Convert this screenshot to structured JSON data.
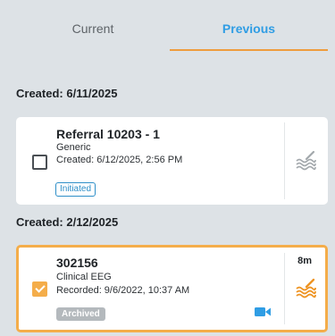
{
  "tabs": [
    {
      "label": "Current",
      "active": false
    },
    {
      "label": "Previous",
      "active": true
    }
  ],
  "accent_color": "#2f9de4",
  "highlight_color": "#f4ad4a",
  "groups": [
    {
      "header": "Created: 6/11/2025",
      "card": {
        "title": "Referral 10203 - 1",
        "type": "Generic",
        "date_line": "Created: 6/12/2025, 2:56 PM",
        "status": "Initiated",
        "checked": false,
        "action_icon": "signal-waves-icon"
      }
    },
    {
      "header": "Created: 2/12/2025",
      "card": {
        "title": "302156",
        "duration": "8m",
        "type": "Clinical EEG",
        "date_line": "Recorded: 9/6/2022, 10:37 AM",
        "status": "Archived",
        "checked": true,
        "has_video": true,
        "action_icon": "signal-waves-icon"
      }
    }
  ]
}
